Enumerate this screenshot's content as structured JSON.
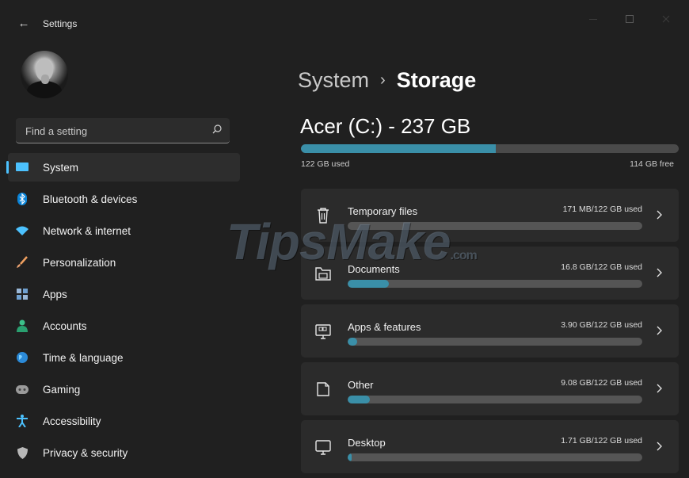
{
  "window": {
    "title": "Settings",
    "back_glyph": "←",
    "controls": [
      "minimize-icon",
      "maximize-icon",
      "close-icon"
    ]
  },
  "search": {
    "placeholder": "Find a setting",
    "icon": "search-icon"
  },
  "sidebar": {
    "items": [
      {
        "label": "System",
        "icon": "system-icon",
        "selected": true
      },
      {
        "label": "Bluetooth & devices",
        "icon": "bluetooth-icon"
      },
      {
        "label": "Network & internet",
        "icon": "wifi-icon"
      },
      {
        "label": "Personalization",
        "icon": "brush-icon"
      },
      {
        "label": "Apps",
        "icon": "apps-icon"
      },
      {
        "label": "Accounts",
        "icon": "person-icon"
      },
      {
        "label": "Time & language",
        "icon": "globe-clock-icon"
      },
      {
        "label": "Gaming",
        "icon": "gamepad-icon"
      },
      {
        "label": "Accessibility",
        "icon": "accessibility-icon"
      },
      {
        "label": "Privacy & security",
        "icon": "shield-icon"
      }
    ]
  },
  "breadcrumb": {
    "parent": "System",
    "separator": "›",
    "current": "Storage"
  },
  "drive": {
    "title": "Acer (C:) - 237 GB",
    "used_label": "122 GB used",
    "free_label": "114 GB free",
    "used_fraction": 0.515
  },
  "categories": [
    {
      "name": "Temporary files",
      "size": "171 MB/122 GB used",
      "fill_fraction": 0.0,
      "icon": "trash-icon"
    },
    {
      "name": "Documents",
      "size": "16.8 GB/122 GB used",
      "fill_fraction": 0.14,
      "icon": "folder-icon"
    },
    {
      "name": "Apps & features",
      "size": "3.90 GB/122 GB used",
      "fill_fraction": 0.032,
      "icon": "apps-features-icon"
    },
    {
      "name": "Other",
      "size": "9.08 GB/122 GB used",
      "fill_fraction": 0.074,
      "icon": "other-file-icon"
    },
    {
      "name": "Desktop",
      "size": "1.71 GB/122 GB used",
      "fill_fraction": 0.014,
      "icon": "monitor-icon"
    }
  ],
  "watermark": {
    "main": "TipsMake",
    "suffix": ".com"
  },
  "colors": {
    "accent": "#4cc2ff",
    "bar_fill": "#3a8fa8",
    "background": "#202020",
    "card": "#2b2b2b"
  }
}
